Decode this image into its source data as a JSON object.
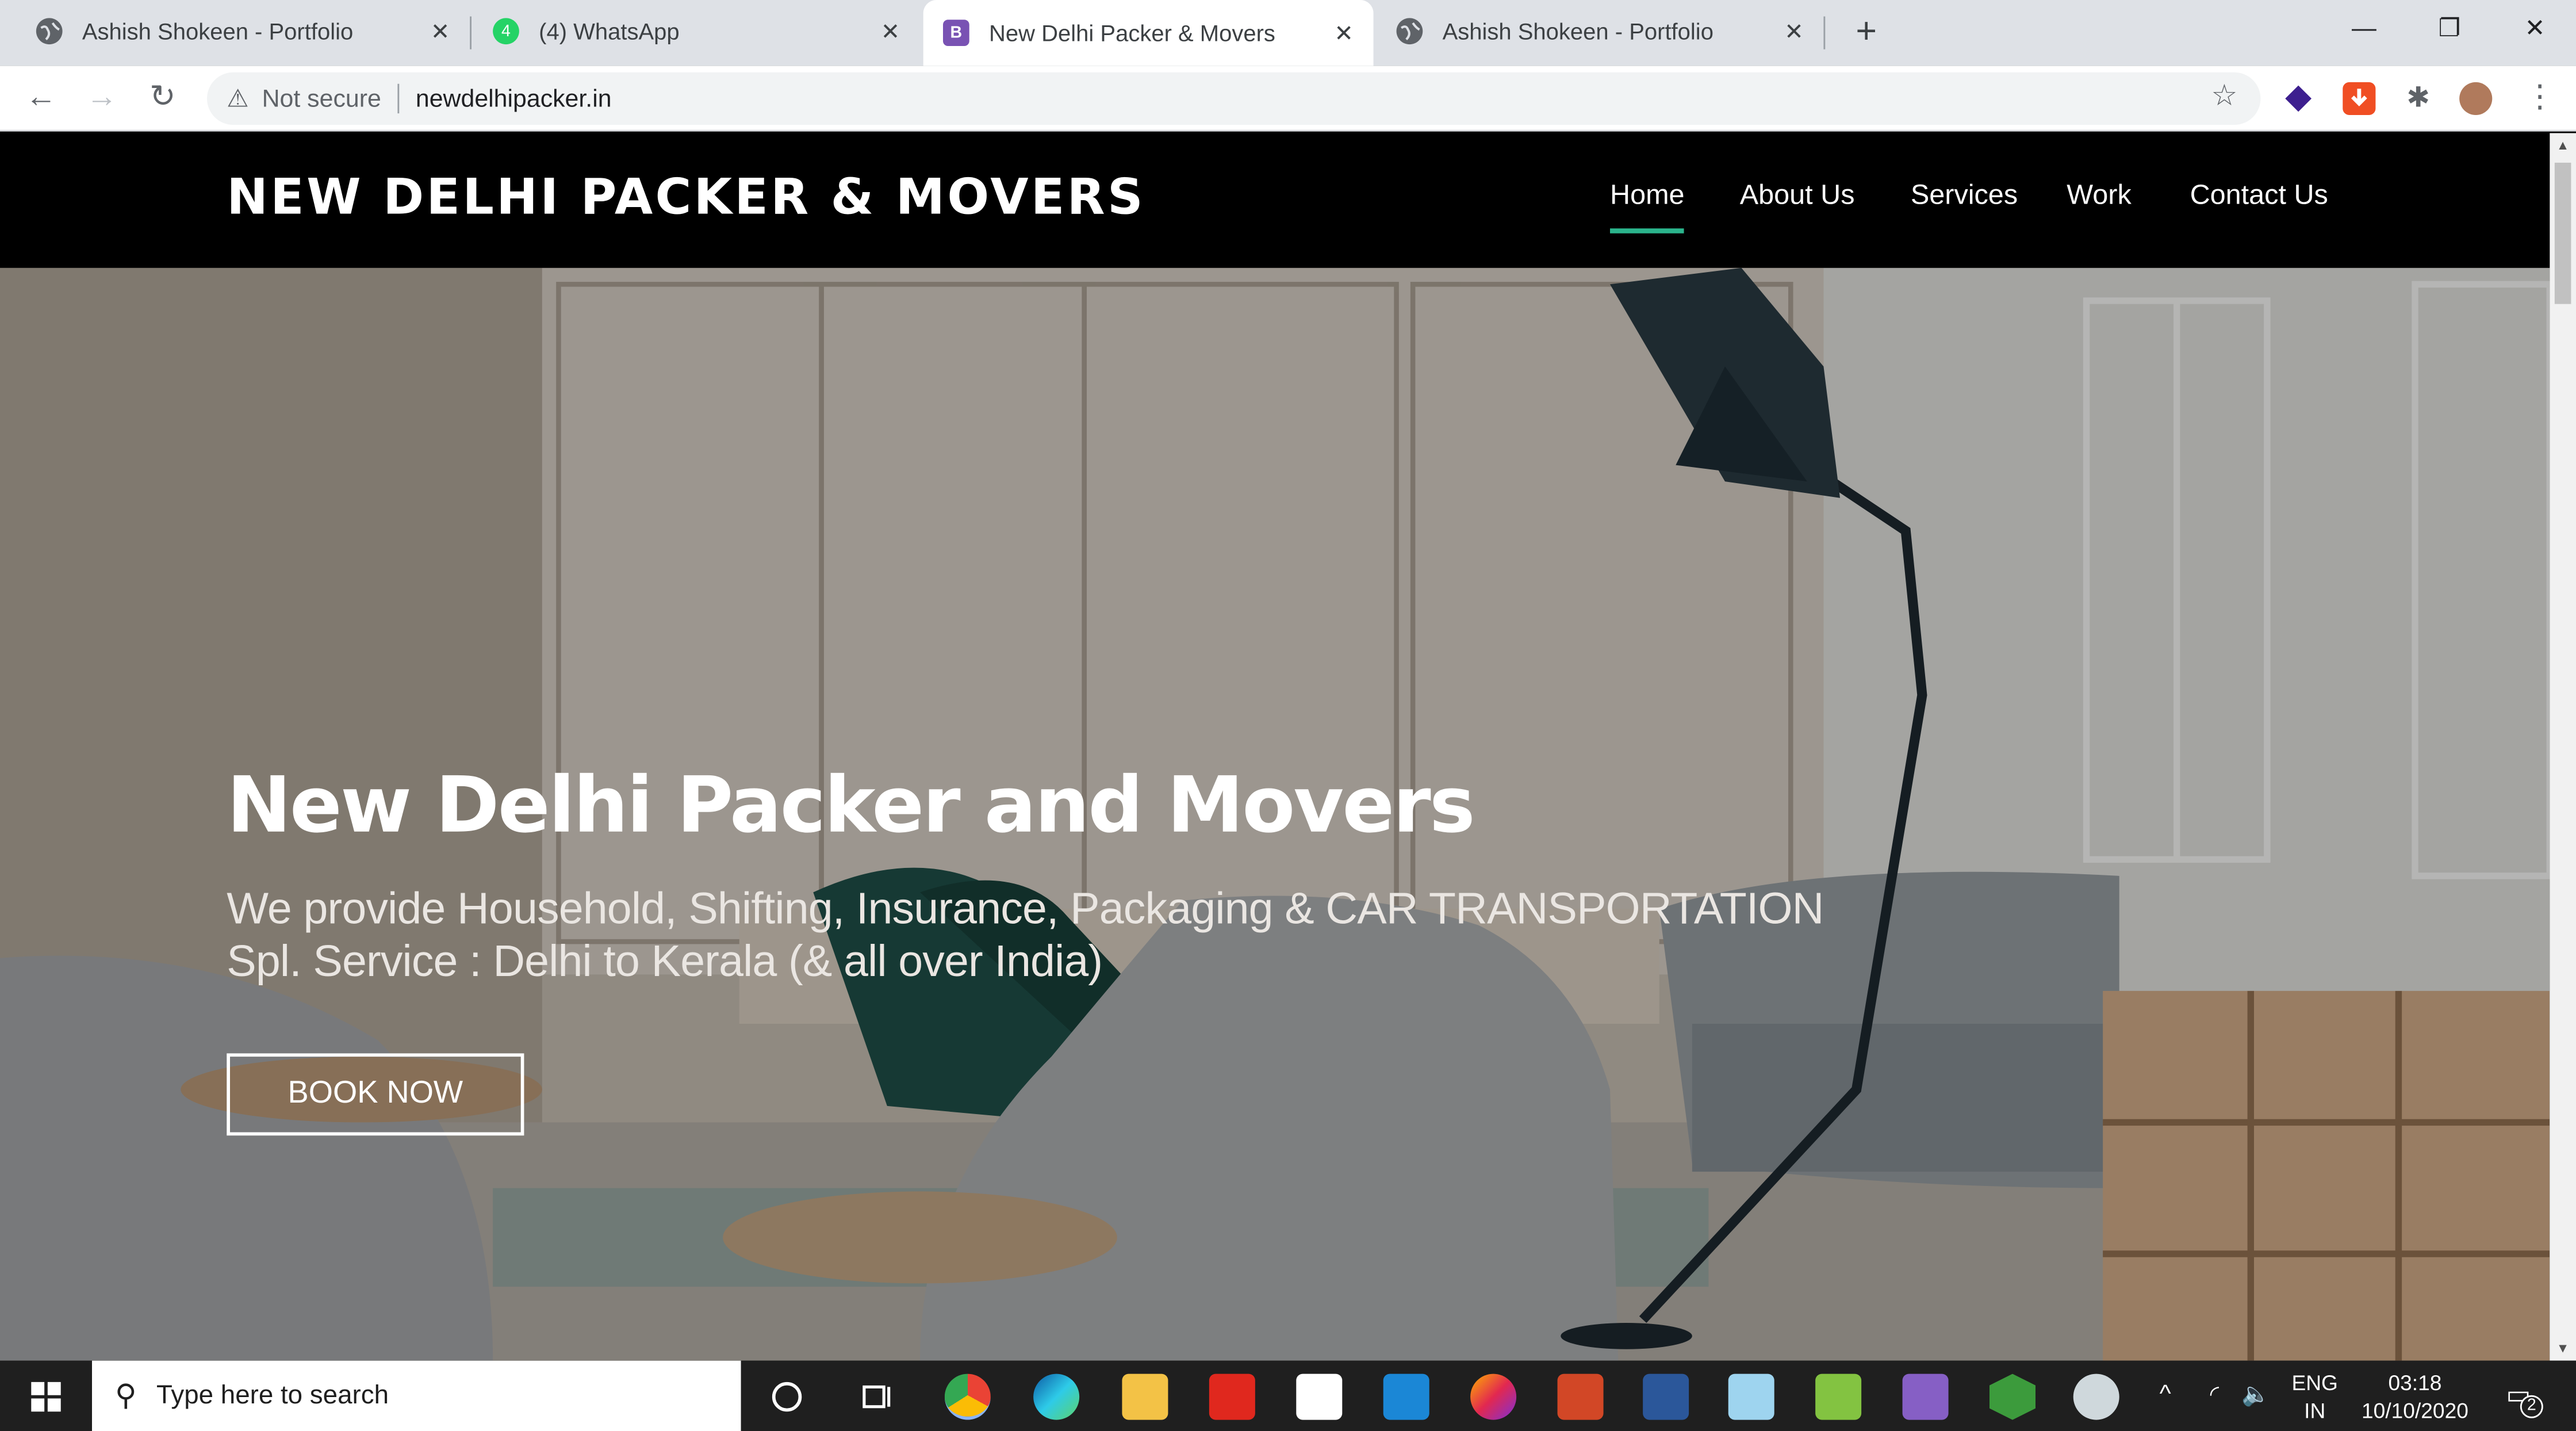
{
  "tabs": [
    {
      "title": "Ashish Shokeen - Portfolio",
      "icon": "globe-icon"
    },
    {
      "title": "(4) WhatsApp",
      "icon": "whatsapp-icon",
      "badge": "4"
    },
    {
      "title": "New Delhi Packer & Movers",
      "icon": "bootstrap-icon",
      "active": true
    },
    {
      "title": "Ashish Shokeen - Portfolio",
      "icon": "globe-icon"
    }
  ],
  "toolbar": {
    "security_label": "Not secure",
    "url": "newdelhipacker.in"
  },
  "site": {
    "brand": "NEW DELHI PACKER & MOVERS",
    "nav": [
      "Home",
      "About Us",
      "Services",
      "Work",
      "Contact Us"
    ],
    "active_nav": "Home",
    "hero_title": "New Delhi Packer and Movers",
    "hero_sub_line1": "We provide Household, Shifting, Insurance, Packaging & CAR TRANSPORTATION",
    "hero_sub_line2": "Spl. Service : Delhi to Kerala (& all over India)",
    "book_button": "BOOK NOW"
  },
  "taskbar": {
    "search_placeholder": "Type here to search",
    "lang_line1": "ENG",
    "lang_line2": "IN",
    "time": "03:18",
    "date": "10/10/2020",
    "notification_count": "2"
  },
  "colors": {
    "accent": "#2bb48c",
    "navbar_bg": "#000000",
    "tabstrip_bg": "#dee1e6",
    "taskbar_bg": "#1f1f1f"
  }
}
